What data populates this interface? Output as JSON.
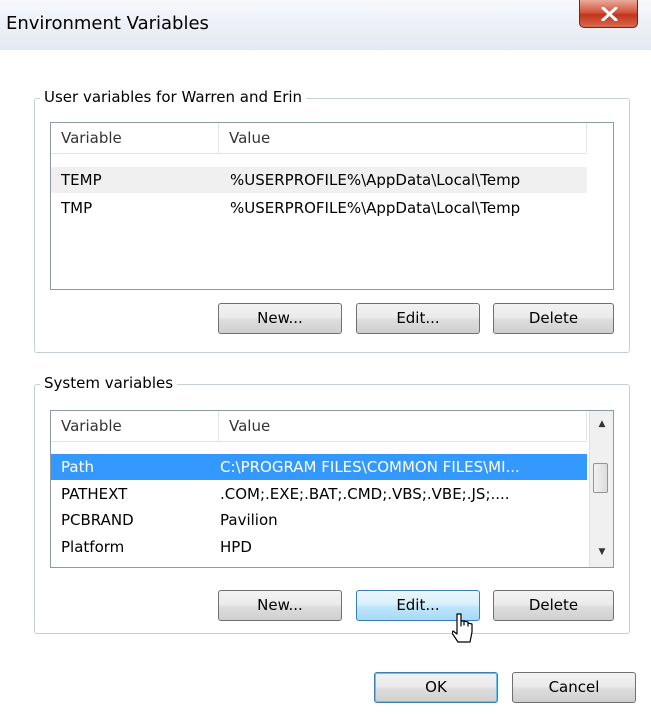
{
  "window": {
    "title": "Environment Variables",
    "close_label": "close"
  },
  "user_vars": {
    "legend": "User variables for Warren and Erin",
    "columns": [
      "Variable",
      "Value"
    ],
    "rows": [
      {
        "variable": "TEMP",
        "value": "%USERPROFILE%\\AppData\\Local\\Temp",
        "state": "hover"
      },
      {
        "variable": "TMP",
        "value": "%USERPROFILE%\\AppData\\Local\\Temp",
        "state": "normal"
      }
    ],
    "buttons": {
      "new": "New...",
      "edit": "Edit...",
      "delete": "Delete"
    }
  },
  "system_vars": {
    "legend": "System variables",
    "columns": [
      "Variable",
      "Value"
    ],
    "rows": [
      {
        "variable": "Path",
        "value": "C:\\PROGRAM FILES\\COMMON FILES\\MI...",
        "state": "selected"
      },
      {
        "variable": "PATHEXT",
        "value": ".COM;.EXE;.BAT;.CMD;.VBS;.VBE;.JS;....",
        "state": "normal"
      },
      {
        "variable": "PCBRAND",
        "value": "Pavilion",
        "state": "normal"
      },
      {
        "variable": "Platform",
        "value": "HPD",
        "state": "normal"
      }
    ],
    "buttons": {
      "new": "New...",
      "edit": "Edit...",
      "delete": "Delete"
    }
  },
  "footer": {
    "ok": "OK",
    "cancel": "Cancel"
  },
  "colors": {
    "selection": "#3399ff",
    "close_button": "#c3341b",
    "hover_button": "#bee6fd"
  }
}
